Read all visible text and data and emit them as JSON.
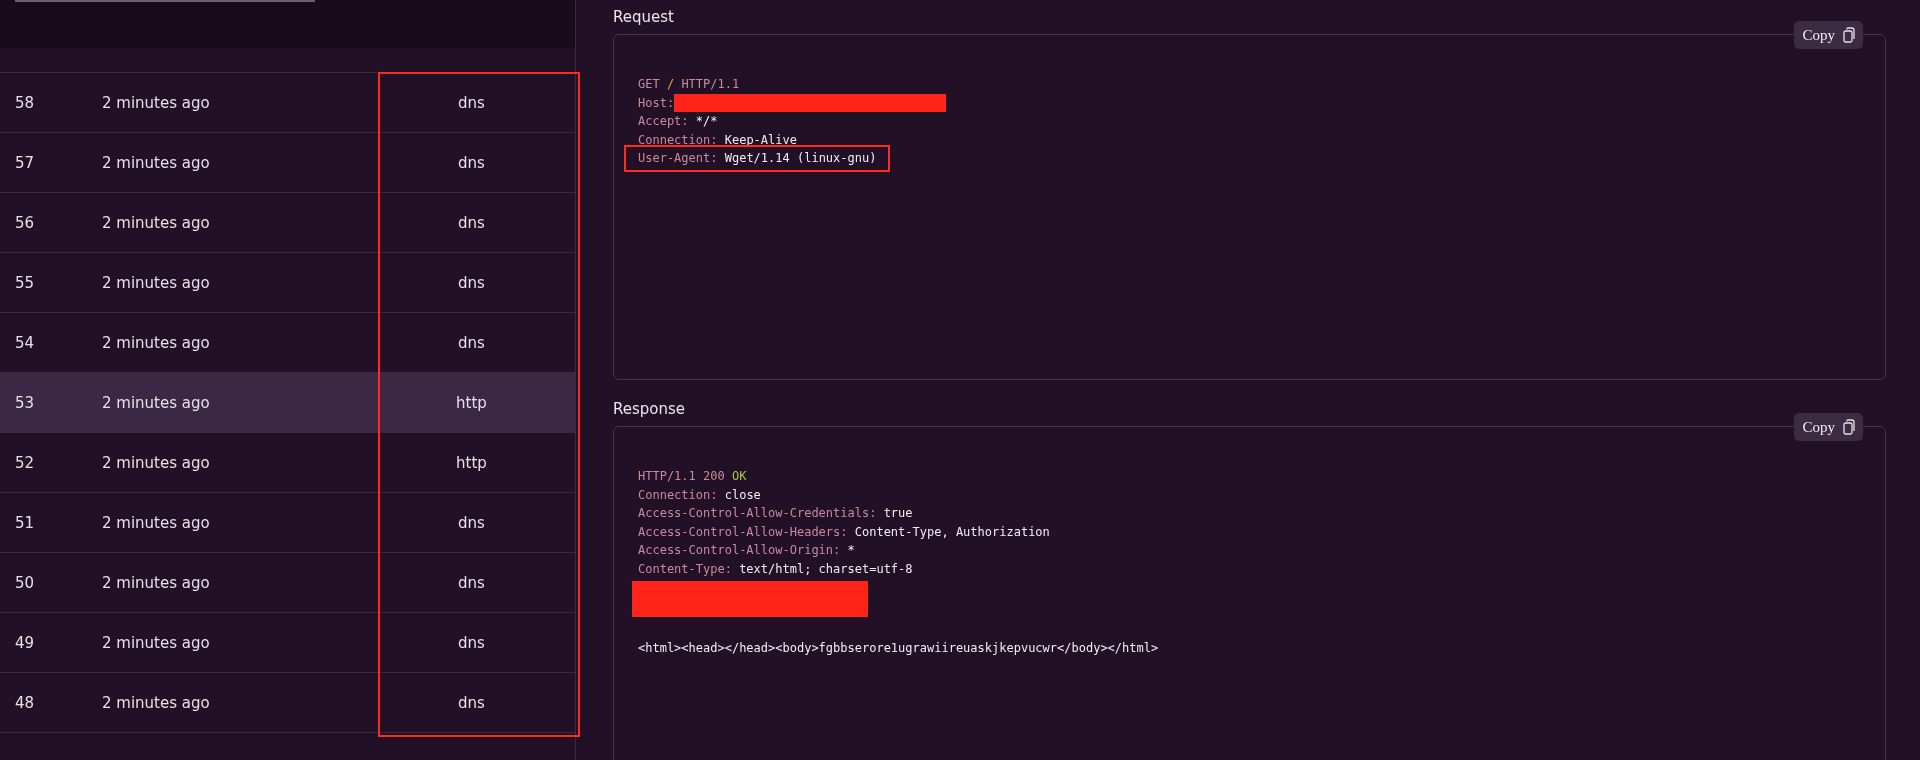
{
  "table": {
    "type_column_highlighted": true,
    "rows": [
      {
        "id": "58",
        "time": "2 minutes ago",
        "type": "dns",
        "selected": false
      },
      {
        "id": "57",
        "time": "2 minutes ago",
        "type": "dns",
        "selected": false
      },
      {
        "id": "56",
        "time": "2 minutes ago",
        "type": "dns",
        "selected": false
      },
      {
        "id": "55",
        "time": "2 minutes ago",
        "type": "dns",
        "selected": false
      },
      {
        "id": "54",
        "time": "2 minutes ago",
        "type": "dns",
        "selected": false
      },
      {
        "id": "53",
        "time": "2 minutes ago",
        "type": "http",
        "selected": true
      },
      {
        "id": "52",
        "time": "2 minutes ago",
        "type": "http",
        "selected": false
      },
      {
        "id": "51",
        "time": "2 minutes ago",
        "type": "dns",
        "selected": false
      },
      {
        "id": "50",
        "time": "2 minutes ago",
        "type": "dns",
        "selected": false
      },
      {
        "id": "49",
        "time": "2 minutes ago",
        "type": "dns",
        "selected": false
      },
      {
        "id": "48",
        "time": "2 minutes ago",
        "type": "dns",
        "selected": false
      }
    ]
  },
  "panels": [
    {
      "title": "Request",
      "copy_label": "Copy",
      "lines": [
        {
          "kind": "text",
          "highlighted": false,
          "segments": [
            {
              "kind": "key",
              "text": "GET"
            },
            {
              "kind": "accent",
              "text": " / "
            },
            {
              "kind": "key",
              "text": "HTTP/1.1"
            }
          ]
        },
        {
          "kind": "text",
          "highlighted": false,
          "segments": [
            {
              "kind": "key",
              "text": "Host:"
            },
            {
              "kind": "redacted"
            }
          ]
        },
        {
          "kind": "text",
          "highlighted": false,
          "segments": [
            {
              "kind": "key",
              "text": "Accept:"
            },
            {
              "kind": "value",
              "text": " */*"
            }
          ]
        },
        {
          "kind": "text",
          "highlighted": false,
          "segments": [
            {
              "kind": "key",
              "text": "Connection:"
            },
            {
              "kind": "value",
              "text": " Keep-Alive"
            }
          ]
        },
        {
          "kind": "text",
          "highlighted": true,
          "segments": [
            {
              "kind": "key",
              "text": "User-Agent:"
            },
            {
              "kind": "value",
              "text": " Wget/1.14 (linux-gnu)"
            }
          ]
        }
      ]
    },
    {
      "title": "Response",
      "copy_label": "Copy",
      "lines": [
        {
          "kind": "text",
          "highlighted": false,
          "segments": [
            {
              "kind": "key",
              "text": "HTTP/1.1 200 "
            },
            {
              "kind": "ok",
              "text": "OK"
            }
          ]
        },
        {
          "kind": "text",
          "highlighted": false,
          "segments": [
            {
              "kind": "key",
              "text": "Connection:"
            },
            {
              "kind": "value",
              "text": " close"
            }
          ]
        },
        {
          "kind": "text",
          "highlighted": false,
          "segments": [
            {
              "kind": "key",
              "text": "Access-Control-Allow-Credentials:"
            },
            {
              "kind": "value",
              "text": " true"
            }
          ]
        },
        {
          "kind": "text",
          "highlighted": false,
          "segments": [
            {
              "kind": "key",
              "text": "Access-Control-Allow-Headers:"
            },
            {
              "kind": "value",
              "text": " Content-Type, Authorization"
            }
          ]
        },
        {
          "kind": "text",
          "highlighted": false,
          "segments": [
            {
              "kind": "key",
              "text": "Access-Control-Allow-Origin:"
            },
            {
              "kind": "value",
              "text": " *"
            }
          ]
        },
        {
          "kind": "text",
          "highlighted": false,
          "segments": [
            {
              "kind": "key",
              "text": "Content-Type:"
            },
            {
              "kind": "value",
              "text": " text/html; charset=utf-8"
            }
          ]
        },
        {
          "kind": "redacted-block"
        },
        {
          "kind": "blank"
        },
        {
          "kind": "text",
          "highlighted": false,
          "segments": [
            {
              "kind": "value",
              "text": "<html><head></head><body>fgbbserore1ugrawiireuaskjkepvucwr</body></html>"
            }
          ]
        }
      ]
    }
  ]
}
